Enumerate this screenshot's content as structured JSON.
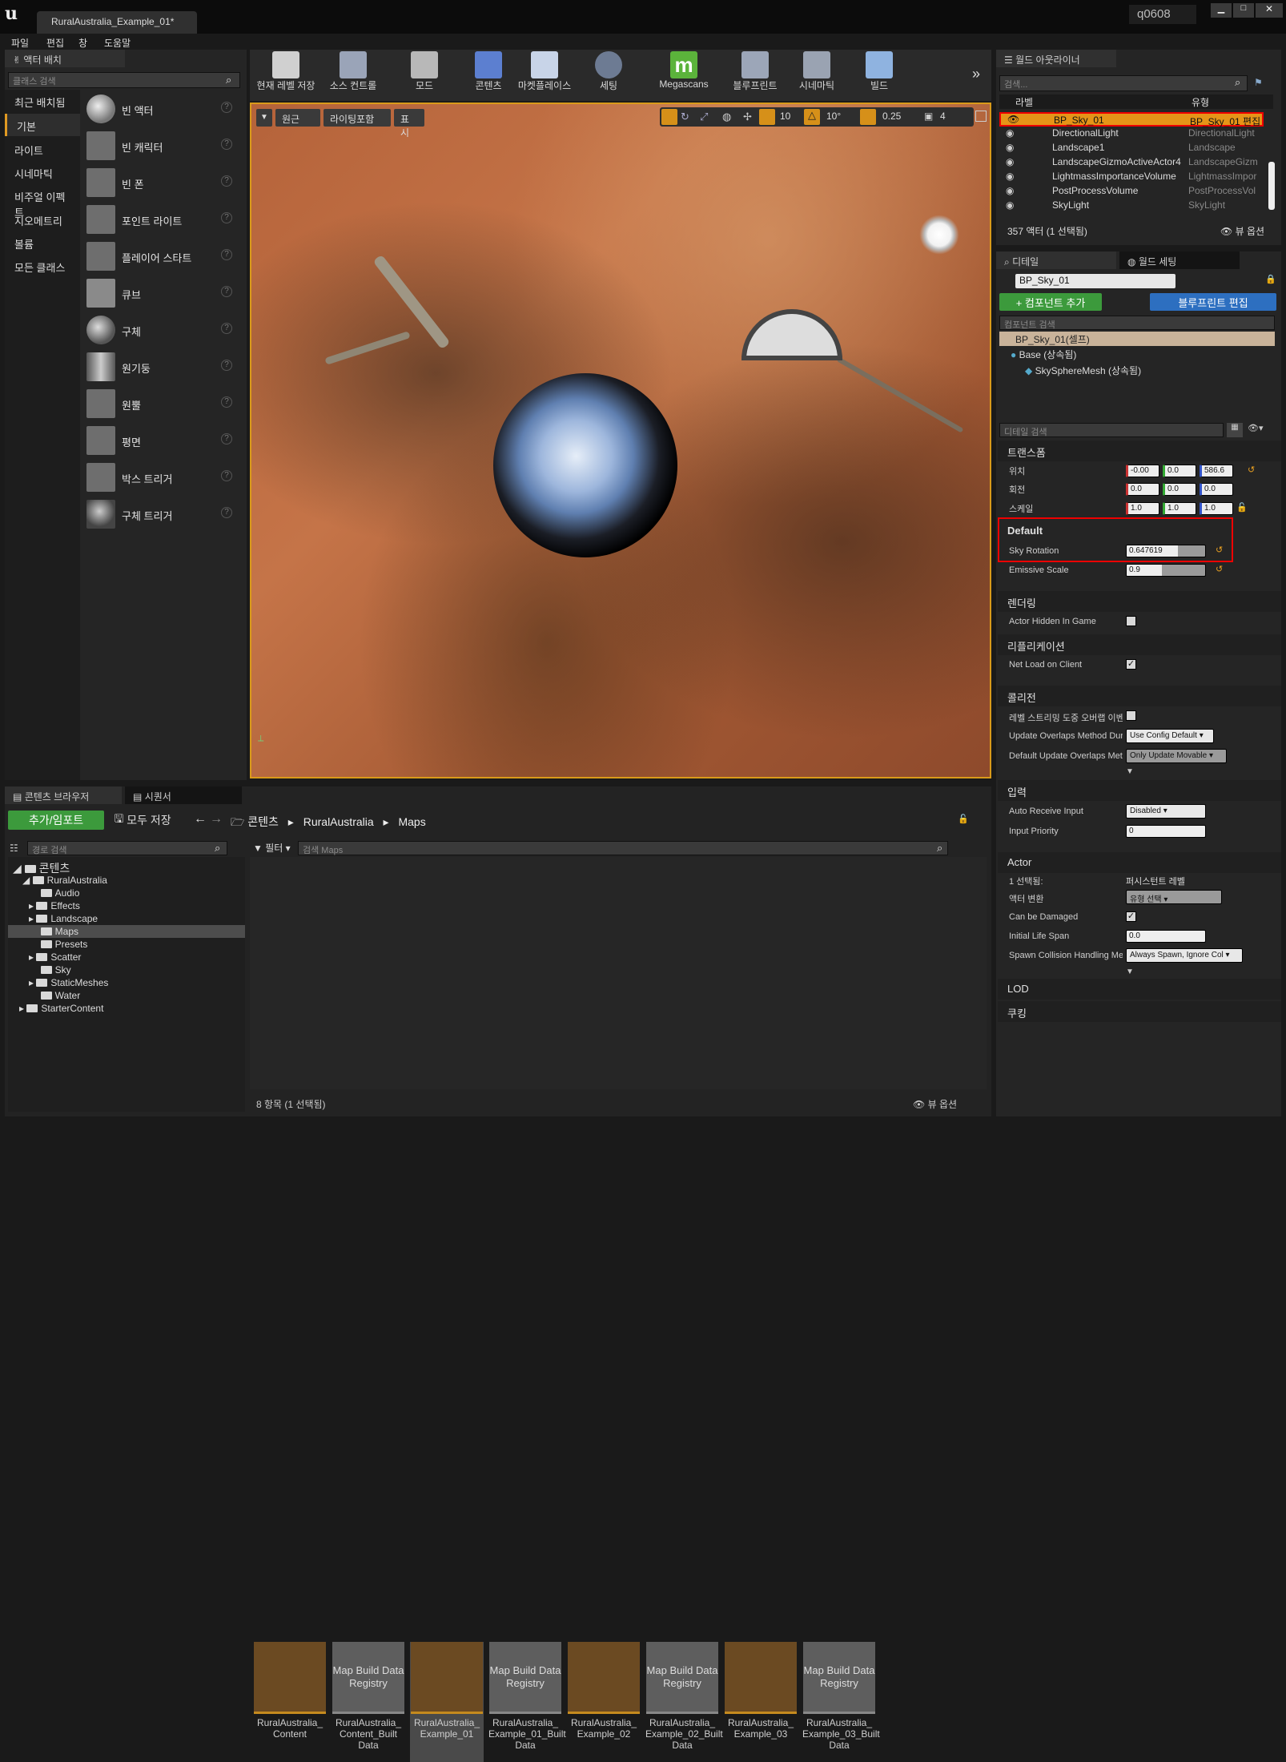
{
  "title_bar": {
    "logo": "ue-logo-icon",
    "tab": "RuralAustralia_Example_01*",
    "user": "q0608"
  },
  "menu": [
    "파일",
    "편집",
    "창",
    "도움말"
  ],
  "place_actors": {
    "tab": "액터 배치",
    "search_placeholder": "클래스 검색",
    "categories": [
      "최근 배치됨",
      "기본",
      "라이트",
      "시네마틱",
      "비주얼 이펙트",
      "지오메트리",
      "볼륨",
      "모든 클래스"
    ],
    "selected_category": "기본",
    "items": [
      "빈 액터",
      "빈 캐릭터",
      "빈 폰",
      "포인트 라이트",
      "플레이어 스타트",
      "큐브",
      "구체",
      "원기둥",
      "원뿔",
      "평면",
      "박스 트리거",
      "구체 트리거"
    ]
  },
  "toolbar": {
    "buttons": [
      "현재 레벨 저장",
      "소스 컨트롤",
      "모드",
      "콘텐츠",
      "마켓플레이스",
      "세팅",
      "Megascans",
      "블루프린트",
      "시네마틱",
      "빌드"
    ]
  },
  "viewport": {
    "perspective_label": "원근",
    "lit_label": "라이팅포함",
    "show_label": "표시",
    "grid_snap": "10",
    "rot_snap": "10°",
    "scale_snap": "0.25",
    "camera_speed": "4"
  },
  "outliner": {
    "tab": "월드 아웃라이너",
    "search_placeholder": "검색...",
    "col_label": "라벨",
    "col_type": "유형",
    "rows": [
      {
        "label": "BP_Sky_01",
        "type": "BP_Sky_01 편집",
        "selected": true
      },
      {
        "label": "DirectionalLight",
        "type": "DirectionalLight"
      },
      {
        "label": "Landscape1",
        "type": "Landscape"
      },
      {
        "label": "LandscapeGizmoActiveActor4",
        "type": "LandscapeGizm"
      },
      {
        "label": "LightmassImportanceVolume",
        "type": "LightmassImpor"
      },
      {
        "label": "PostProcessVolume",
        "type": "PostProcessVol"
      },
      {
        "label": "SkyLight",
        "type": "SkyLight"
      }
    ],
    "footer": "357 액터 (1 선택됨)",
    "view_options": "뷰 옵션"
  },
  "details": {
    "tab_details": "디테일",
    "tab_world": "월드 세팅",
    "actor_name": "BP_Sky_01",
    "add_component": "+ 컴포넌트 추가",
    "edit_blueprint": "블루프린트 편집",
    "component_search": "컴포넌트 검색",
    "self_item": "BP_Sky_01(셀프)",
    "base_item": "Base (상속됨)",
    "mesh_item": "SkySphereMesh (상속됨)",
    "details_search": "디테일 검색",
    "transform": {
      "section": "트랜스폼",
      "location_label": "위치",
      "rotation_label": "회전",
      "scale_label": "스케일",
      "location": [
        "-0.00",
        "0.0",
        "586.6"
      ],
      "rotation": [
        "0.0",
        "0.0",
        "0.0"
      ],
      "scale": [
        "1.0",
        "1.0",
        "1.0"
      ]
    },
    "default": {
      "section": "Default",
      "sky_rotation_label": "Sky Rotation",
      "sky_rotation": "0.647619",
      "sky_rotation_fill": 0.65,
      "emissive_label": "Emissive Scale",
      "emissive": "0.9",
      "emissive_fill": 0.45
    },
    "rendering": {
      "section": "렌더링",
      "hidden_label": "Actor Hidden In Game",
      "hidden": false
    },
    "replication": {
      "section": "리플리케이션",
      "net_load_label": "Net Load on Client",
      "net_load": true
    },
    "collision": {
      "section": "콜리전",
      "streaming_label": "레벨 스트리밍 도중 오버랩 이벤",
      "update_label": "Update Overlaps Method Dur",
      "update_value": "Use Config Default",
      "default_label": "Default Update Overlaps Met",
      "default_value": "Only Update Movable"
    },
    "input": {
      "section": "입력",
      "auto_label": "Auto Receive Input",
      "auto_value": "Disabled",
      "priority_label": "Input Priority",
      "priority_value": "0"
    },
    "actor": {
      "section": "Actor",
      "selected_label": "1 선택됨:",
      "selected_value": "퍼시스턴트 레벨",
      "convert_label": "액터 변환",
      "convert_value": "유형 선택",
      "damage_label": "Can be Damaged",
      "life_label": "Initial Life Span",
      "life_value": "0.0",
      "spawn_label": "Spawn Collision Handling Me",
      "spawn_value": "Always Spawn, Ignore Col"
    },
    "lod": "LOD",
    "cooking": "쿠킹"
  },
  "content_browser": {
    "tab": "콘텐츠 브라우저",
    "tab2": "시퀀서",
    "add_import": "추가/임포트",
    "save_all": "모두 저장",
    "path": [
      "콘텐츠",
      "RuralAustralia",
      "Maps"
    ],
    "path_search": "경로 검색",
    "filter": "필터",
    "search_placeholder": "검색 Maps",
    "tree": [
      {
        "name": "콘텐츠",
        "indent": 0,
        "root": true
      },
      {
        "name": "RuralAustralia",
        "indent": 1
      },
      {
        "name": "Audio",
        "indent": 2
      },
      {
        "name": "Effects",
        "indent": 2
      },
      {
        "name": "Landscape",
        "indent": 2
      },
      {
        "name": "Maps",
        "indent": 2,
        "selected": true
      },
      {
        "name": "Presets",
        "indent": 2
      },
      {
        "name": "Scatter",
        "indent": 2
      },
      {
        "name": "Sky",
        "indent": 2
      },
      {
        "name": "StaticMeshes",
        "indent": 2
      },
      {
        "name": "Water",
        "indent": 2
      },
      {
        "name": "StarterContent",
        "indent": 1
      }
    ],
    "assets": [
      {
        "kind": "map",
        "name": "RuralAustralia_ Content"
      },
      {
        "kind": "reg",
        "tile": "Map Build Data Registry",
        "name": "RuralAustralia_ Content_Built Data"
      },
      {
        "kind": "map",
        "name": "RuralAustralia_ Example_01",
        "selected": true
      },
      {
        "kind": "reg",
        "tile": "Map Build Data Registry",
        "name": "RuralAustralia_ Example_01_Built Data"
      },
      {
        "kind": "map",
        "name": "RuralAustralia_ Example_02"
      },
      {
        "kind": "reg",
        "tile": "Map Build Data Registry",
        "name": "RuralAustralia_ Example_02_Built Data"
      },
      {
        "kind": "map",
        "name": "RuralAustralia_ Example_03"
      },
      {
        "kind": "reg",
        "tile": "Map Build Data Registry",
        "name": "RuralAustralia_ Example_03_Built Data"
      }
    ],
    "footer": "8 항목 (1 선택됨)",
    "view_options": "뷰 옵션"
  }
}
